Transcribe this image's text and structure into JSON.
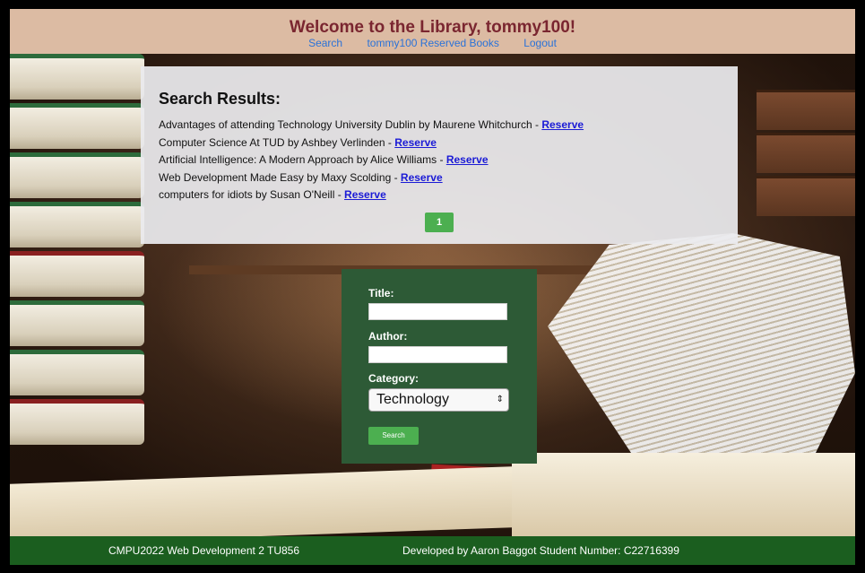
{
  "header": {
    "welcome": "Welcome to the Library, tommy100!",
    "nav": [
      {
        "label": "Search"
      },
      {
        "label": "tommy100 Reserved Books"
      },
      {
        "label": "Logout"
      }
    ]
  },
  "results": {
    "title": "Search Results:",
    "items": [
      {
        "text": "Advantages of attending Technology University Dublin by Maurene Whitchurch - ",
        "link": "Reserve"
      },
      {
        "text": "Computer Science At TUD by Ashbey Verlinden - ",
        "link": "Reserve"
      },
      {
        "text": "Artificial Intelligence: A Modern Approach by Alice Williams - ",
        "link": "Reserve"
      },
      {
        "text": "Web Development Made Easy by Maxy Scolding - ",
        "link": "Reserve"
      },
      {
        "text": "computers for idiots by Susan O'Neill - ",
        "link": "Reserve"
      }
    ],
    "page": "1"
  },
  "form": {
    "title_label": "Title:",
    "title_value": "",
    "author_label": "Author:",
    "author_value": "",
    "category_label": "Category:",
    "category_selected": "Technology",
    "search_label": "Search"
  },
  "footer": {
    "left": "CMPU2022 Web Development 2 TU856",
    "right": "Developed by Aaron Baggot Student Number: C22716399"
  },
  "colors": {
    "header_bg": "#dcbba3",
    "welcome": "#7a2630",
    "nav_link": "#2a72d8",
    "accent_green": "#4caf50",
    "form_bg": "#2d5a36",
    "footer_bg": "#1b5e1f",
    "reserve_link": "#1b1bd6"
  }
}
